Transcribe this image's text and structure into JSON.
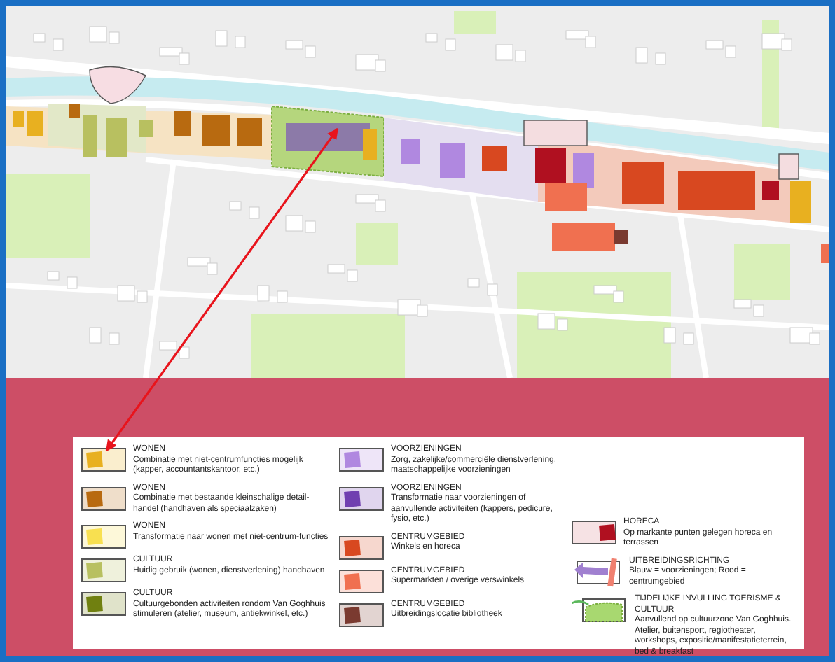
{
  "legend": {
    "columns": [
      {
        "items": [
          {
            "kind": "swatch",
            "color": "#e8b020",
            "title": "WONEN",
            "description": "Combinatie met niet-centrumfuncties mogelijk (kapper, accountantskantoor, etc.)"
          },
          {
            "kind": "swatch",
            "color": "#b86a10",
            "title": "WONEN",
            "description": "Combinatie met bestaande kleinschalige detail-handel (handhaven als speciaalzaken)"
          },
          {
            "kind": "swatch",
            "color": "#f8e050",
            "title": "WONEN",
            "description": "Transformatie naar wonen met niet-centrum-functies"
          },
          {
            "kind": "swatch",
            "color": "#b8c060",
            "title": "CULTUUR",
            "description": "Huidig gebruik (wonen, dienstverlening) handhaven"
          },
          {
            "kind": "swatch",
            "color": "#708010",
            "title": "CULTUUR",
            "description": "Cultuurgebonden activiteiten rondom Van Goghhuis stimuleren (atelier, museum, antiekwinkel, etc.)"
          }
        ]
      },
      {
        "items": [
          {
            "kind": "swatch",
            "color": "#b088e0",
            "title": "VOORZIENINGEN",
            "description": "Zorg, zakelijke/commerciële dienstverlening, maatschappelijke voorzieningen"
          },
          {
            "kind": "swatch",
            "color": "#7040b0",
            "title": "VOORZIENINGEN",
            "description": "Transformatie naar voorzieningen of aanvullende activiteiten (kappers, pedicure, fysio, etc.)"
          },
          {
            "kind": "swatch",
            "color": "#d84820",
            "title": "CENTRUMGEBIED",
            "description": "Winkels en horeca"
          },
          {
            "kind": "swatch",
            "color": "#f07050",
            "title": "CENTRUMGEBIED",
            "description": "Supermarkten / overige verswinkels"
          },
          {
            "kind": "swatch",
            "color": "#7a3a30",
            "title": "CENTRUMGEBIED",
            "description": "Uitbreidingslocatie bibliotheek"
          }
        ]
      },
      {
        "items": [
          {
            "kind": "swatch-right",
            "color": "#b01020",
            "title": "HORECA",
            "description": "Op markante punten gelegen horeca en terrassen"
          },
          {
            "kind": "direction",
            "color": "#a080d0",
            "title": "UITBREIDINGSRICHTING",
            "description": "Blauw = voorzieningen; Rood = centrumgebied"
          },
          {
            "kind": "temporary",
            "color": "#a8d870",
            "title": "TIJDELIJKE INVULLING TOERISME & CULTUUR",
            "description": "Aanvullend op cultuurzone Van Goghhuis. Atelier, buitensport, regiotheater, workshops, expositie/manifestatieterrein, bed & breakfast"
          }
        ]
      }
    ]
  }
}
